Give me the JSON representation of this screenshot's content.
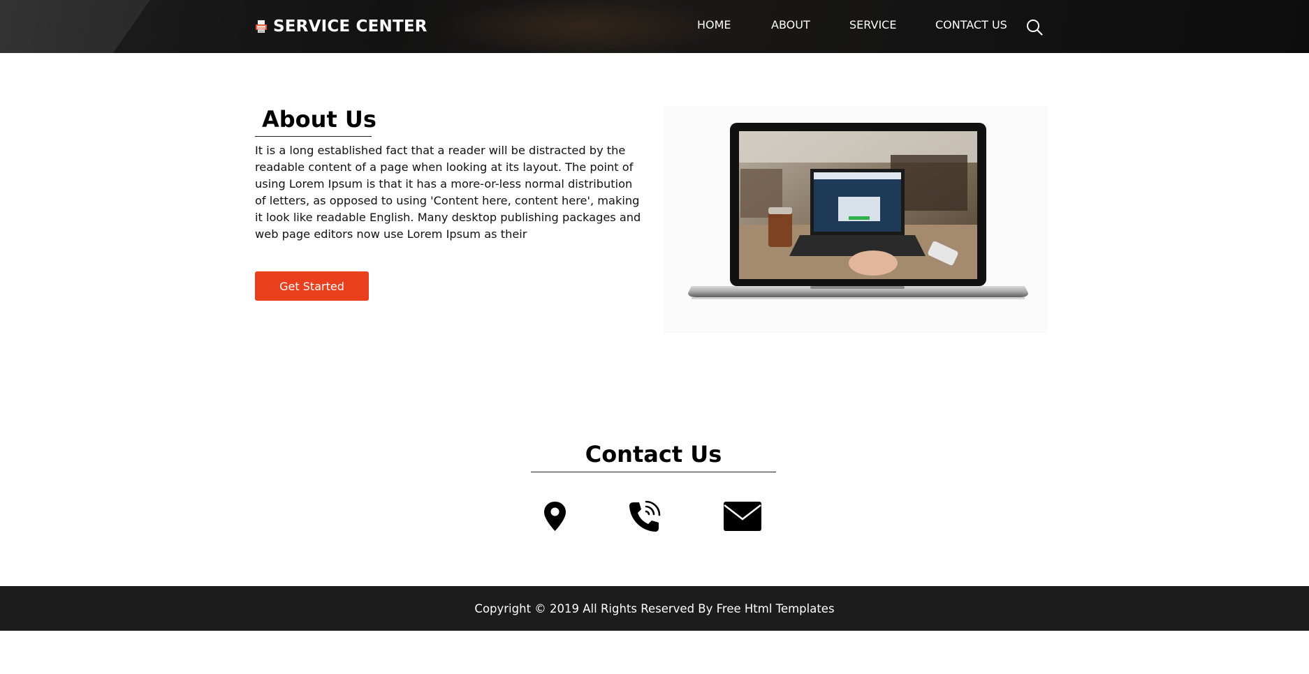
{
  "header": {
    "brand": "SERVICE CENTER",
    "nav": [
      {
        "label": "HOME"
      },
      {
        "label": "ABOUT"
      },
      {
        "label": "SERVICE"
      },
      {
        "label": "CONTACT US"
      }
    ]
  },
  "about": {
    "title": "About Us",
    "body": "It is a long established fact that a reader will be distracted by the readable content of a page when looking at its layout. The point of using Lorem Ipsum is that it has a more-or-less normal distribution of letters, as opposed to using 'Content here, content here', making it look like readable English. Many desktop publishing packages and web page editors now use Lorem Ipsum as their",
    "button_label": "Get Started"
  },
  "contact": {
    "title": "Contact Us",
    "icons": [
      "location-pin-icon",
      "phone-icon",
      "envelope-icon"
    ]
  },
  "footer": {
    "copyright": "Copyright © 2019 All Rights Reserved By Free Html Templates"
  },
  "colors": {
    "accent": "#ea3f1d",
    "header_bg": "#121212",
    "footer_bg": "#1c1c1c"
  }
}
